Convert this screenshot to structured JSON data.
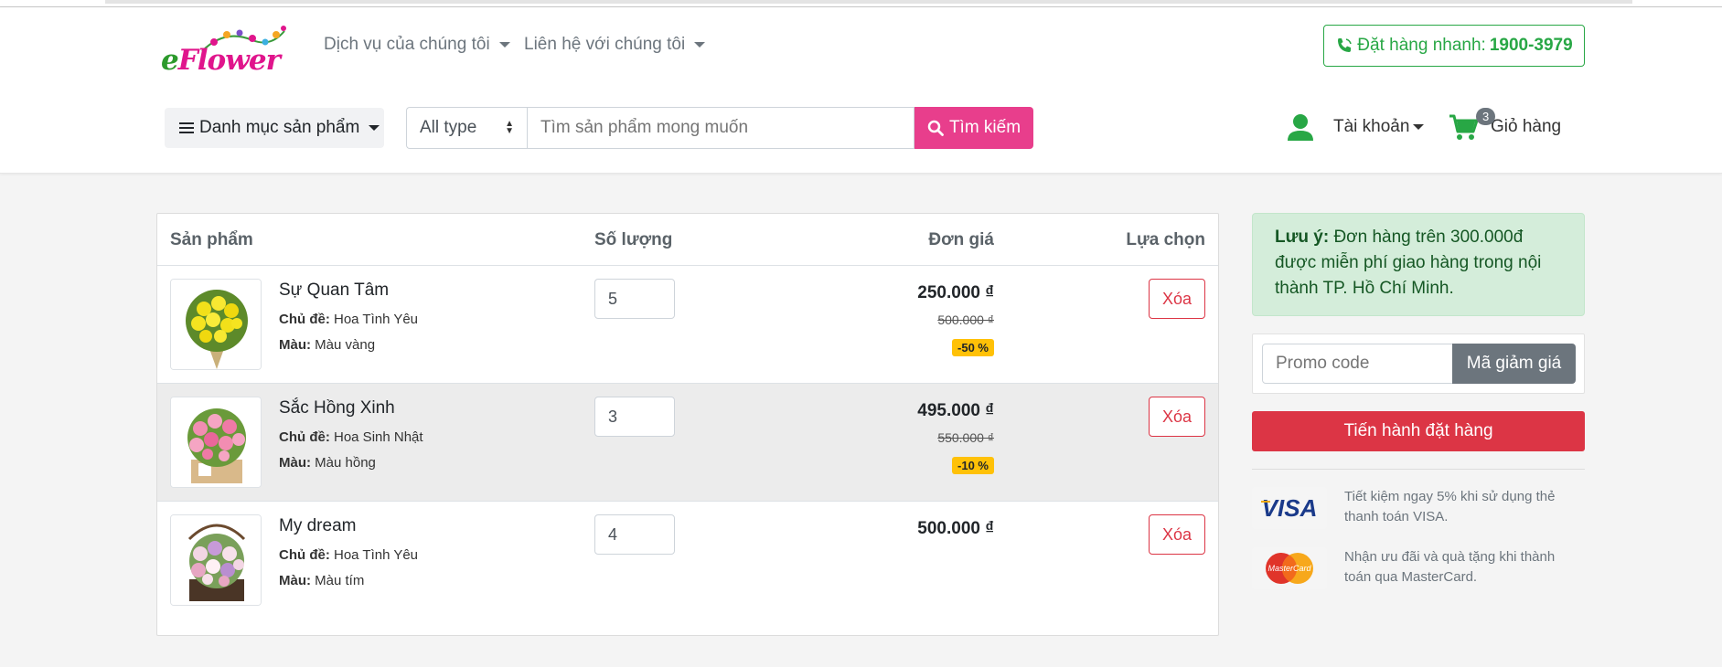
{
  "header": {
    "logo_text": "eFlower",
    "nav": [
      {
        "label": "Dịch vụ của chúng tôi"
      },
      {
        "label": "Liên hệ với chúng tôi"
      }
    ],
    "hotline_label": "Đặt hàng nhanh:",
    "hotline_number": "1900-3979",
    "category_button": "Danh mục sản phẩm",
    "type_select_value": "All type",
    "search_placeholder": "Tìm sản phẩm mong muốn",
    "search_button": "Tìm kiếm",
    "account_label": "Tài khoản",
    "cart_label": "Giỏ hàng",
    "cart_count": "3"
  },
  "cart": {
    "columns": {
      "product": "Sản phẩm",
      "quantity": "Số lượng",
      "price": "Đơn giá",
      "action": "Lựa chọn"
    },
    "items": [
      {
        "name": "Sự Quan Tâm",
        "topic_label": "Chủ đề:",
        "topic": "Hoa Tình Yêu",
        "color_label": "Màu:",
        "color": "Màu vàng",
        "quantity": "5",
        "price": "250.000 ₫",
        "old_price": "500.000 ₫",
        "discount": "-50 %",
        "delete_label": "Xóa"
      },
      {
        "name": "Sắc Hồng Xinh",
        "topic_label": "Chủ đề:",
        "topic": "Hoa Sinh Nhật",
        "color_label": "Màu:",
        "color": "Màu hồng",
        "quantity": "3",
        "price": "495.000 ₫",
        "old_price": "550.000 ₫",
        "discount": "-10 %",
        "delete_label": "Xóa"
      },
      {
        "name": "My dream",
        "topic_label": "Chủ đề:",
        "topic": "Hoa Tình Yêu",
        "color_label": "Màu:",
        "color": "Màu tím",
        "quantity": "4",
        "price": "500.000 ₫",
        "delete_label": "Xóa"
      }
    ]
  },
  "sidebar": {
    "note_title": "Lưu ý:",
    "note_text": "Đơn hàng trên 300.000đ được miễn phí giao hàng trong nội thành TP. Hồ Chí Minh.",
    "promo_placeholder": "Promo code",
    "promo_button": "Mã giảm giá",
    "checkout_button": "Tiến hành đặt hàng",
    "payments": [
      {
        "card": "VISA",
        "text": "Tiết kiệm ngay 5% khi sử dụng thẻ thanh toán VISA."
      },
      {
        "card": "MasterCard",
        "text": "Nhận ưu đãi và quà tặng khi thành toán qua MasterCard."
      }
    ]
  },
  "colors": {
    "brand_pink": "#e83e8c",
    "success_green": "#28a745",
    "danger_red": "#dc3545",
    "note_bg": "#d4edda"
  }
}
